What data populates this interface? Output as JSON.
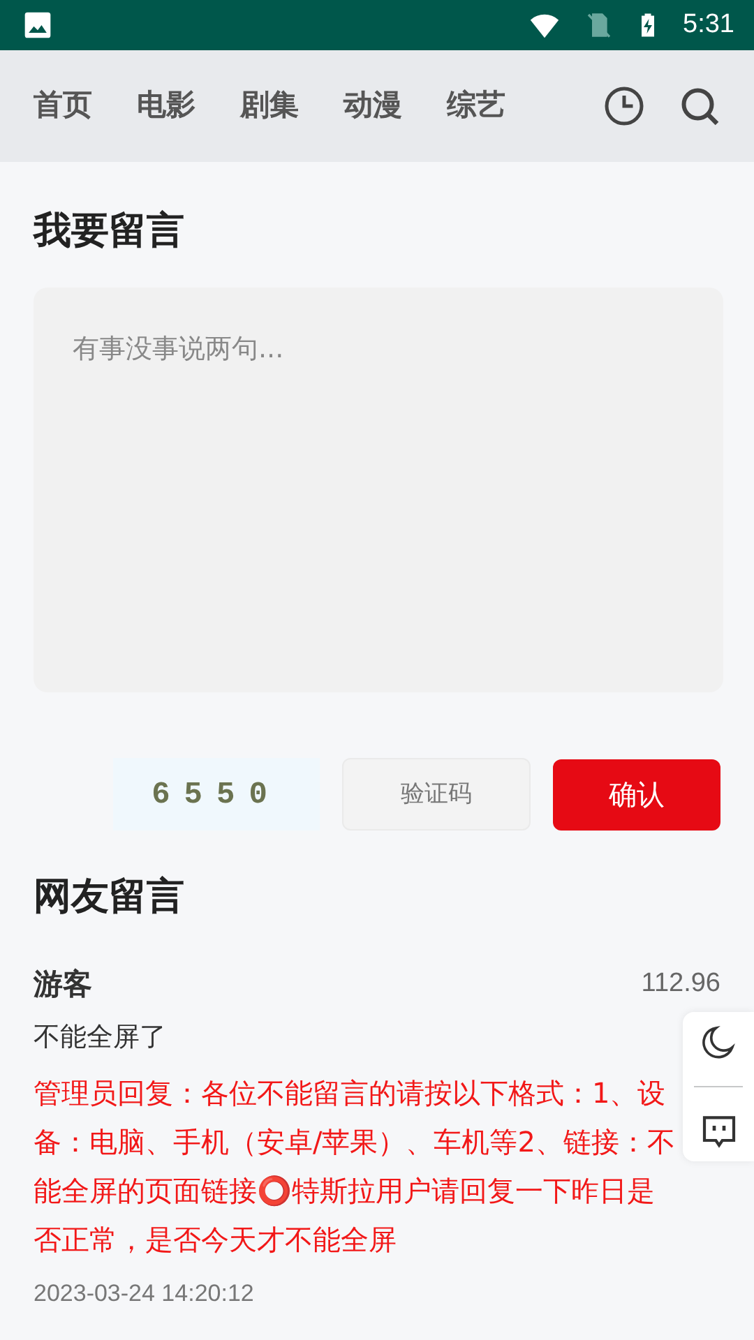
{
  "status_bar": {
    "time": "5:31"
  },
  "nav": {
    "tabs": [
      {
        "label": "首页",
        "selected": false
      },
      {
        "label": "电影",
        "selected": false
      },
      {
        "label": "剧集",
        "selected": false
      },
      {
        "label": "动漫",
        "selected": false
      },
      {
        "label": "综艺",
        "selected": false
      }
    ]
  },
  "compose": {
    "title": "我要留言",
    "placeholder": "有事没事说两句...",
    "captcha": "6550",
    "captcha_placeholder": "验证码",
    "submit": "确认"
  },
  "comments_title": "网友留言",
  "comments": [
    {
      "author": "游客",
      "ip": "112.96",
      "text": "不能全屏了",
      "reply": "管理员回复：各位不能留言的请按以下格式：1、设备：电脑、手机（安卓/苹果）、车机等2、链接：不能全屏的页面链接⭕特斯拉用户请回复一下昨日是否正常，是否今天才不能全屏",
      "date": "2023-03-24 14:20:12"
    }
  ]
}
